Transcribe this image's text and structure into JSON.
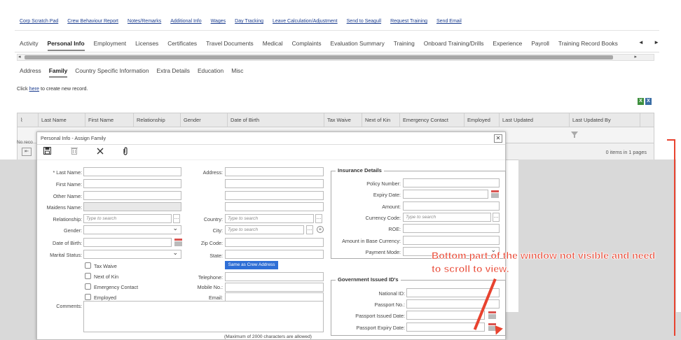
{
  "top_links": [
    "Corp Scratch Pad",
    "Crew Behaviour Report",
    "Notes/Remarks",
    "Additional Info",
    "Wages",
    "Day Tracking",
    "Leave Calculation/Adjustment",
    "Send to Seagull",
    "Request Training",
    "Send Email"
  ],
  "main_tabs": [
    "Activity",
    "Personal Info",
    "Employment",
    "Licenses",
    "Certificates",
    "Travel Documents",
    "Medical",
    "Complaints",
    "Evaluation Summary",
    "Training",
    "Onboard Training/Drills",
    "Experience",
    "Payroll",
    "Training Record Books"
  ],
  "main_tabs_active": "Personal Info",
  "tab_nav": {
    "prev": "◄",
    "next": "►"
  },
  "sub_tabs": [
    "Address",
    "Family",
    "Country Specific Information",
    "Extra Details",
    "Education",
    "Misc"
  ],
  "sub_tabs_active": "Family",
  "create_record": {
    "prefix": "Click ",
    "link": "here",
    "suffix": " to create new record."
  },
  "grid": {
    "columns": [
      "",
      "Last Name",
      "First Name",
      "Relationship",
      "Gender",
      "Date of Birth",
      "Tax Waive",
      "Next of Kin",
      "Emergency Contact",
      "Employed",
      "Last Updated",
      "Last Updated By"
    ],
    "no_records": "No reco",
    "pager_info": "0 items in 1 pages"
  },
  "dialog": {
    "title": "Personal Info - Assign Family",
    "left_labels": [
      "* Last Name:",
      "First Name:",
      "Other Name:",
      "Maidens Name:",
      "Relationship:",
      "Gender:",
      "Date of Birth:",
      "Marital Status:"
    ],
    "relationship_placeholder": "Type to search",
    "checkboxes": [
      "Tax Waive",
      "Next of Kin",
      "Emergency Contact",
      "Employed"
    ],
    "comments_label": "Comments:",
    "mid_labels": [
      "Address:",
      "Country:",
      "City:",
      "Zip Code:",
      "State:",
      "Telephone:",
      "Mobile No.:",
      "Email:"
    ],
    "country_placeholder": "Type to search",
    "city_placeholder": "Type to search",
    "same_as_crew": "Same as Crew Address",
    "max_chars": "(Maximum of 2000 characters are allowed)",
    "insurance": {
      "legend": "Insurance Details",
      "labels": [
        "Policy Number:",
        "Expiry Date:",
        "Amount:",
        "Currency Code:",
        "ROE:",
        "Amount in Base Currency:",
        "Payment Mode:"
      ],
      "currency_placeholder": "Type to search"
    },
    "government": {
      "legend": "Government Issued ID's",
      "labels": [
        "National ID:",
        "Passport No.:",
        "Passport Issued Date:",
        "Passport Expiry Date:"
      ]
    }
  },
  "annotation": "Bottom part of the window not visible and need to scroll to view.",
  "colors": {
    "link": "#1b3d8f",
    "annotation": "#e8432f",
    "button": "#2f6fd6"
  }
}
